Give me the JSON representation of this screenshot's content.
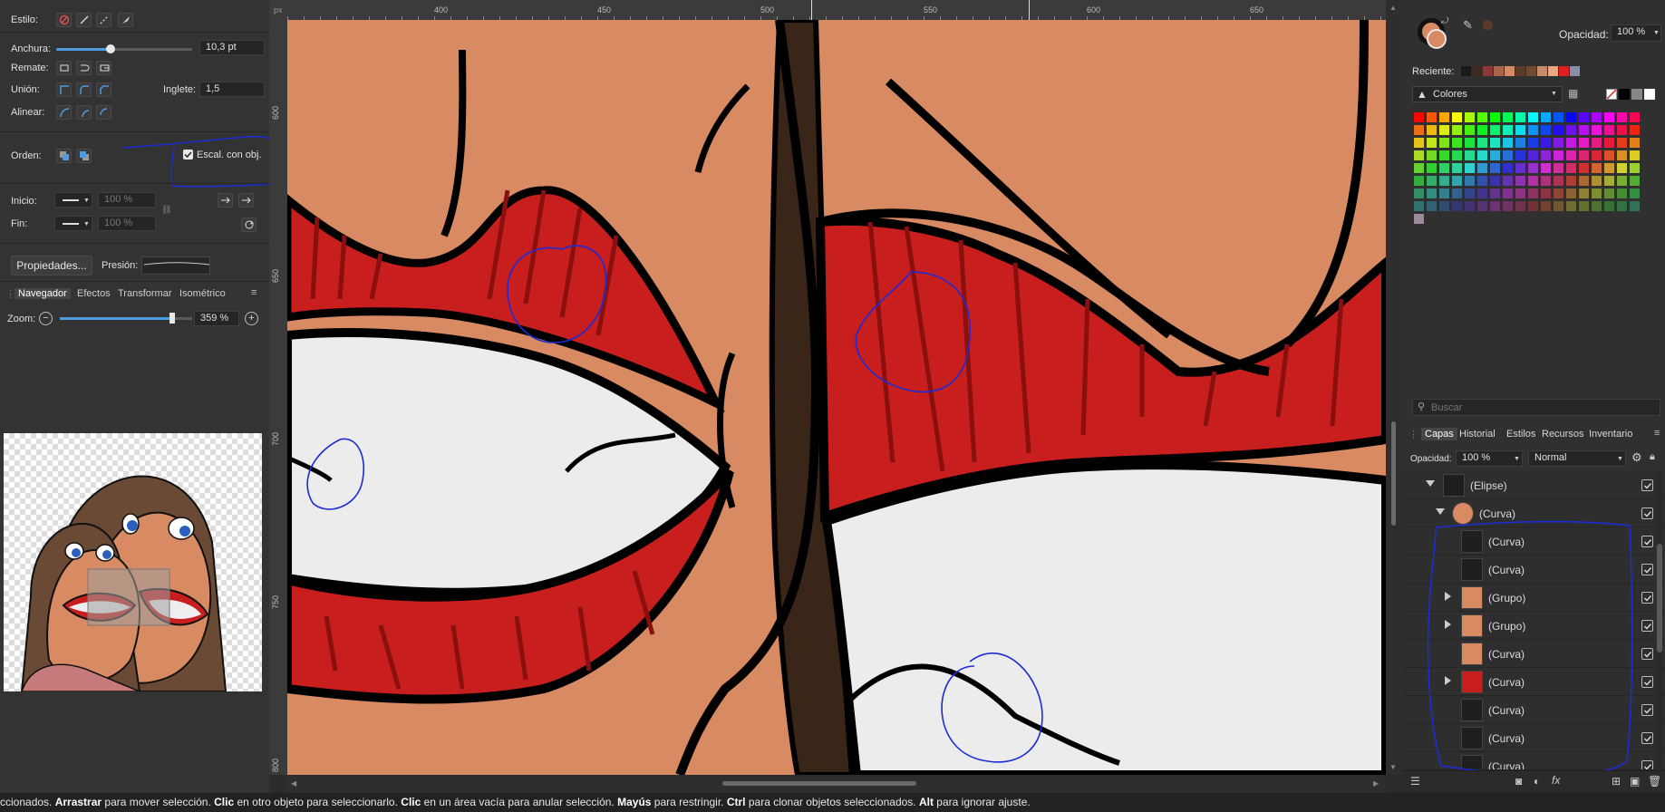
{
  "context_toolbar": {
    "estilo_label": "Estilo:",
    "anchura_label": "Anchura:",
    "anchura_value": "10,3 pt",
    "anchura_fraction": 0.4,
    "remate_label": "Remate:",
    "union_label": "Unión:",
    "inglete_label": "Inglete:",
    "inglete_value": "1,5",
    "alinear_label": "Alinear:",
    "orden_label": "Orden:",
    "escal_label": "Escal. con obj.",
    "inicio_label": "Inicio:",
    "inicio_value": "100 %",
    "fin_label": "Fin:",
    "fin_value": "100 %",
    "propiedades_label": "Propiedades...",
    "presion_label": "Presión:"
  },
  "navigator": {
    "tabs": [
      "Navegador",
      "Efectos",
      "Transformar",
      "Isométrico"
    ],
    "zoom_label": "Zoom:",
    "zoom_value": "359 %",
    "zoom_fraction": 0.85
  },
  "ruler": {
    "unit": "px",
    "top_ticks": [
      "400",
      "450",
      "500",
      "550",
      "600",
      "650"
    ],
    "left_ticks": [
      "600",
      "650",
      "700",
      "750",
      "800"
    ]
  },
  "color_panel": {
    "opacidad_label": "Opacidad:",
    "opacidad_value": "100 %",
    "reciente_label": "Reciente:",
    "palette_name": "Colores",
    "recent_colors": [
      "#1a1a1a",
      "#3a2a22",
      "#8a3a3a",
      "#a8654d",
      "#d48a62",
      "#5b3a2a",
      "#6e4b32",
      "#c78b6b",
      "#e8a882",
      "#e02020",
      "#8a8fa8"
    ]
  },
  "search": {
    "placeholder": "Buscar"
  },
  "layers_panel": {
    "tabs": [
      "Capas",
      "Historial",
      "Estilos",
      "Recursos",
      "Inventario"
    ],
    "opacidad_label": "Opacidad:",
    "opacidad_value": "100 %",
    "blend_mode": "Normal",
    "layers": [
      {
        "name": "(Elipse)"
      },
      {
        "name": "(Curva)"
      },
      {
        "name": "(Curva)"
      },
      {
        "name": "(Curva)"
      },
      {
        "name": "(Grupo)"
      },
      {
        "name": "(Grupo)"
      },
      {
        "name": "(Curva)"
      },
      {
        "name": "(Curva)"
      },
      {
        "name": "(Curva)"
      },
      {
        "name": "(Curva)"
      },
      {
        "name": "(Curva)"
      }
    ]
  },
  "status_bar": {
    "t1": "ccionados. ",
    "b1": "Arrastrar",
    "t2": " para mover selección. ",
    "b2": "Clic",
    "t3": " en otro objeto para seleccionarlo. ",
    "b3": "Clic",
    "t4": " en un área vacía para anular selección. ",
    "b4": "Mayús",
    "t5": " para restringir. ",
    "b5": "Ctrl",
    "t6": " para clonar objetos seleccionados. ",
    "b6": "Alt",
    "t7": " para ignorar ajuste."
  }
}
